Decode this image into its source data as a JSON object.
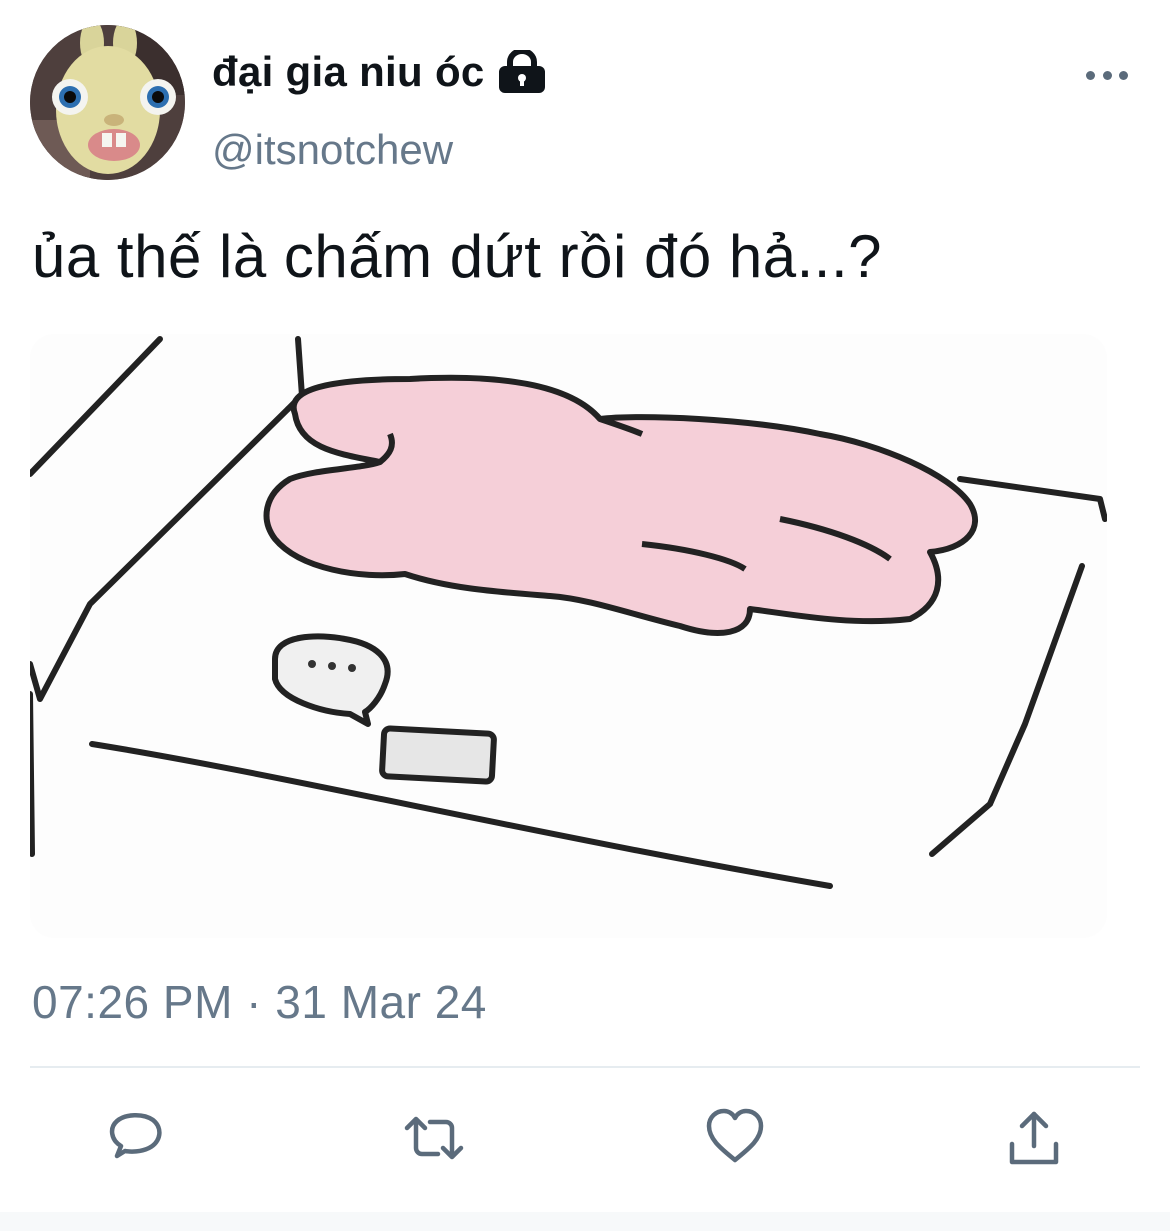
{
  "user": {
    "display_name": "đại gia niu óc",
    "handle": "@itsnotchew",
    "protected_icon": "lock-icon",
    "avatar_icon": "rabbid-avatar"
  },
  "tweet": {
    "text": "ủa thế là chấm dứt rồi đó hả...?",
    "timestamp": "07:26 PM · 31 Mar 24"
  },
  "actions": [
    {
      "name": "reply",
      "icon": "speech-bubble-icon"
    },
    {
      "name": "retweet",
      "icon": "retweet-arrows-icon"
    },
    {
      "name": "like",
      "icon": "heart-icon"
    },
    {
      "name": "share",
      "icon": "upload-share-icon"
    }
  ],
  "colors": {
    "text": "#0f1419",
    "secondary": "#66788a",
    "icon": "#5b6b7b",
    "divider": "#e6ecf0",
    "bunny": "#f5cfd8"
  }
}
